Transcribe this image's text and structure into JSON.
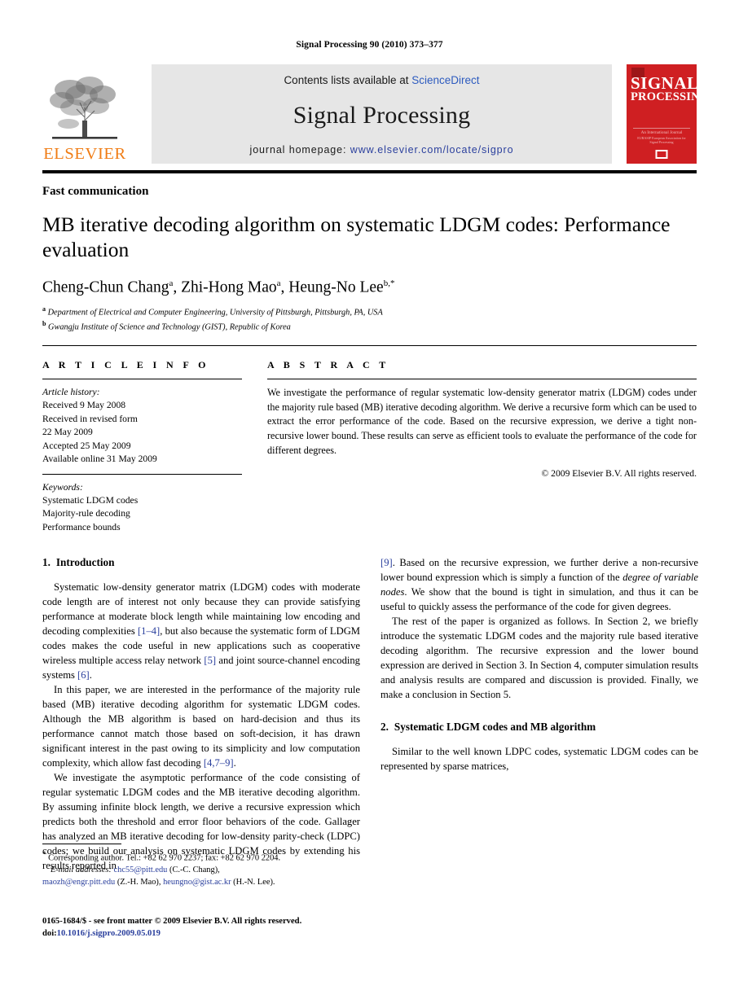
{
  "running_head": "Signal Processing 90 (2010) 373–377",
  "masthead": {
    "contents_prefix": "Contents lists available at ",
    "sciencedirect": "ScienceDirect",
    "journal_title": "Signal Processing",
    "homepage_prefix": "journal homepage: ",
    "homepage_url": "www.elsevier.com/locate/sigpro",
    "publisher_word": "ELSEVIER",
    "cover": {
      "line1": "SIGNAL",
      "line2": "PROCESSING",
      "sub1": "An International Journal",
      "sub2": "EURASIP European Association for Signal Processing"
    },
    "accent_gray": "#e6e6e6",
    "cover_red": "#cf1f22",
    "elsevier_orange": "#F07C14",
    "link_blue": "#2a3f9d"
  },
  "article": {
    "doctype": "Fast communication",
    "title": "MB iterative decoding algorithm on systematic LDGM codes: Performance evaluation",
    "authors": [
      {
        "name": "Cheng-Chun Chang",
        "marks": "a"
      },
      {
        "name": "Zhi-Hong Mao",
        "marks": "a"
      },
      {
        "name": "Heung-No Lee",
        "marks": "b,*"
      }
    ],
    "affiliations": [
      {
        "mark": "a",
        "text": "Department of Electrical and Computer Engineering, University of Pittsburgh, Pittsburgh, PA, USA"
      },
      {
        "mark": "b",
        "text": "Gwangju Institute of Science and Technology (GIST), Republic of Korea"
      }
    ]
  },
  "article_info": {
    "heading": "A R T I C L E  I N F O",
    "history_label": "Article history:",
    "history": [
      "Received 9 May 2008",
      "Received in revised form",
      "22 May 2009",
      "Accepted 25 May 2009",
      "Available online 31 May 2009"
    ],
    "keywords_label": "Keywords:",
    "keywords": [
      "Systematic LDGM codes",
      "Majority-rule decoding",
      "Performance bounds"
    ]
  },
  "abstract": {
    "heading": "A B S T R A C T",
    "text": "We investigate the performance of regular systematic low-density generator matrix (LDGM) codes under the majority rule based (MB) iterative decoding algorithm. We derive a recursive form which can be used to extract the error performance of the code. Based on the recursive expression, we derive a tight non-recursive lower bound. These results can serve as efficient tools to evaluate the performance of the code for different degrees.",
    "copyright": "© 2009 Elsevier B.V. All rights reserved."
  },
  "sections": {
    "intro": {
      "number": "1.",
      "title": "Introduction",
      "p1_a": "Systematic low-density generator matrix (LDGM) codes with moderate code length are of interest not only because they can provide satisfying performance at moderate block length while maintaining low encoding and decoding complexities ",
      "p1_ref1": "[1–4]",
      "p1_b": ", but also because the systematic form of LDGM codes makes the code useful in new applications such as cooperative wireless multiple access relay network ",
      "p1_ref2": "[5]",
      "p1_c": " and joint source-channel encoding systems ",
      "p1_ref3": "[6]",
      "p1_d": ".",
      "p2_a": "In this paper, we are interested in the performance of the majority rule based (MB) iterative decoding algorithm for systematic LDGM codes. Although the MB algorithm is based on hard-decision and thus its performance cannot match those based on soft-decision, it has drawn significant interest in the past owing to its simplicity and low computation complexity, which allow fast decoding ",
      "p2_ref": "[4,7–9]",
      "p2_b": ".",
      "p3_a": "We investigate the asymptotic performance of the code consisting of regular systematic LDGM codes and the MB iterative decoding algorithm. By assuming infinite block length, we derive a recursive expression which predicts both the threshold and error floor behaviors of the code. Gallager has analyzed an MB iterative decoding for low-density parity-check (LDPC) codes; we build our analysis on systematic LDGM codes by extending his results reported in ",
      "p3_ref": "[9]",
      "p3_b": ". Based on the recursive expression, we further derive a non-recursive lower bound expression which is simply a function of the ",
      "p3_ital": "degree of variable nodes",
      "p3_c": ". We show that the bound is tight in simulation, and thus it can be useful to quickly assess the performance of the code for given degrees.",
      "p4": "The rest of the paper is organized as follows. In Section 2, we briefly introduce the systematic LDGM codes and the majority rule based iterative decoding algorithm. The recursive expression and the lower bound expression are derived in Section 3. In Section 4, computer simulation results and analysis results are compared and discussion is provided. Finally, we make a conclusion in Section 5."
    },
    "sec2": {
      "number": "2.",
      "title": "Systematic LDGM codes and MB algorithm",
      "p1": "Similar to the well known LDPC codes, systematic LDGM codes can be represented by sparse matrices,"
    }
  },
  "footnotes": {
    "corresponding": "Corresponding author. Tel.: +82 62 970 2237; fax: +82 62 970 2204.",
    "email_label": "E-mail addresses:",
    "email1": "chc55@pitt.edu",
    "email1_owner": " (C.-C. Chang),",
    "email2": "maozh@engr.pitt.edu",
    "email2_owner": " (Z.-H. Mao),",
    "email3": "heungno@gist.ac.kr",
    "email3_owner": " (H.-N. Lee)."
  },
  "issn": {
    "line1": "0165-1684/$ - see front matter © 2009 Elsevier B.V. All rights reserved.",
    "doi_label": "doi:",
    "doi_value": "10.1016/j.sigpro.2009.05.019"
  }
}
